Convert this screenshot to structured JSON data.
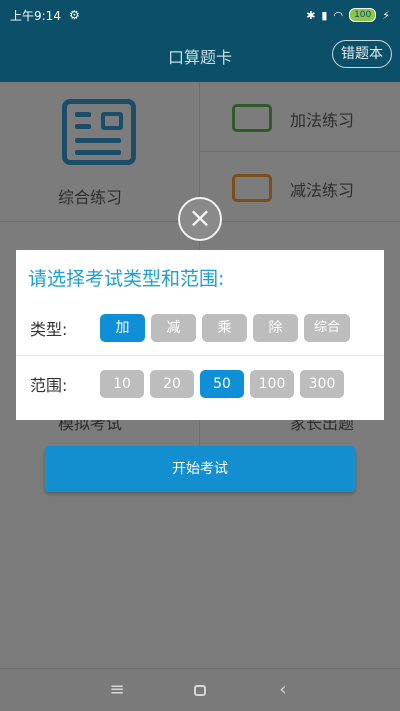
{
  "status_bar": {
    "time": "上午9:14",
    "battery": "100"
  },
  "app_bar": {
    "title": "口算题卡",
    "error_book_label": "错题本"
  },
  "menu": {
    "comprehensive": "综合练习",
    "addition": "加法练习",
    "subtraction": "减法练习",
    "mock_exam": "模拟考试",
    "home_quiz": "家长出题"
  },
  "dialog": {
    "title": "请选择考试类型和范围:",
    "type_label": "类型:",
    "types": [
      "加",
      "减",
      "乘",
      "除",
      "综合"
    ],
    "selected_type": "加",
    "range_label": "范围:",
    "ranges": [
      "10",
      "20",
      "50",
      "100",
      "300"
    ],
    "selected_range": "50"
  },
  "start_button": "开始考试",
  "colors": {
    "accent": "#0f8fd6",
    "title": "#1e9ed8",
    "chip_inactive": "#bdbdbd"
  },
  "icons": [
    "close-icon",
    "menu-icon",
    "home-icon",
    "back-icon",
    "settings-icon",
    "wifi-icon",
    "signal-icon",
    "bluetooth-icon"
  ]
}
